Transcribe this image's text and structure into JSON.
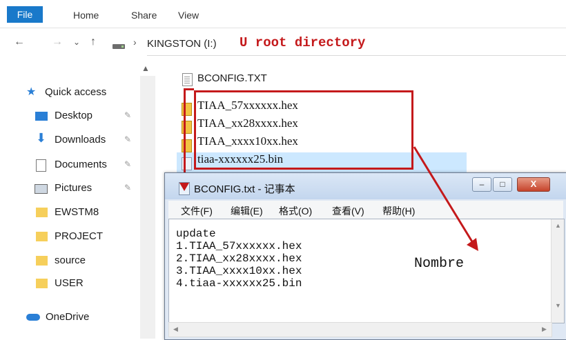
{
  "ribbon": {
    "file": "File",
    "tabs": [
      "Home",
      "Share",
      "View"
    ]
  },
  "address": {
    "back": "←",
    "forward": "→",
    "recent": "⌄",
    "up": "↑",
    "separator": "›",
    "path": "KINGSTON (I:)"
  },
  "annotations": {
    "root": "U root directory",
    "nombre": "Nombre",
    "color": "#c4191b"
  },
  "nav": {
    "quick_access": "Quick access",
    "items": [
      {
        "label": "Desktop",
        "icon": "desktop-icon",
        "pinned": true
      },
      {
        "label": "Downloads",
        "icon": "downloads-icon",
        "pinned": true
      },
      {
        "label": "Documents",
        "icon": "documents-icon",
        "pinned": true
      },
      {
        "label": "Pictures",
        "icon": "pictures-icon",
        "pinned": true
      },
      {
        "label": "EWSTM8",
        "icon": "folder-icon",
        "pinned": false
      },
      {
        "label": "PROJECT",
        "icon": "folder-icon",
        "pinned": false
      },
      {
        "label": "source",
        "icon": "folder-icon",
        "pinned": false
      },
      {
        "label": "USER",
        "icon": "folder-icon",
        "pinned": false
      }
    ],
    "onedrive": "OneDrive",
    "pin_glyph": "✎"
  },
  "files": {
    "items": [
      "BCONFIG.TXT",
      "TIAA_57xxxxxx.hex",
      "TIAA_xx28xxxx.hex",
      "TIAA_xxxx10xx.hex",
      "tiaa-xxxxxx25.bin"
    ]
  },
  "notepad": {
    "title": "BCONFIG.txt - 记事本",
    "menu": [
      "文件(F)",
      "编辑(E)",
      "格式(O)",
      "查看(V)",
      "帮助(H)"
    ],
    "lines": [
      "update",
      "1.TIAA_57xxxxxx.hex",
      "2.TIAA_xx28xxxx.hex",
      "3.TIAA_xxxx10xx.hex",
      "4.tiaa-xxxxxx25.bin"
    ],
    "minimize": "–",
    "maximize": "□",
    "close": "X"
  }
}
